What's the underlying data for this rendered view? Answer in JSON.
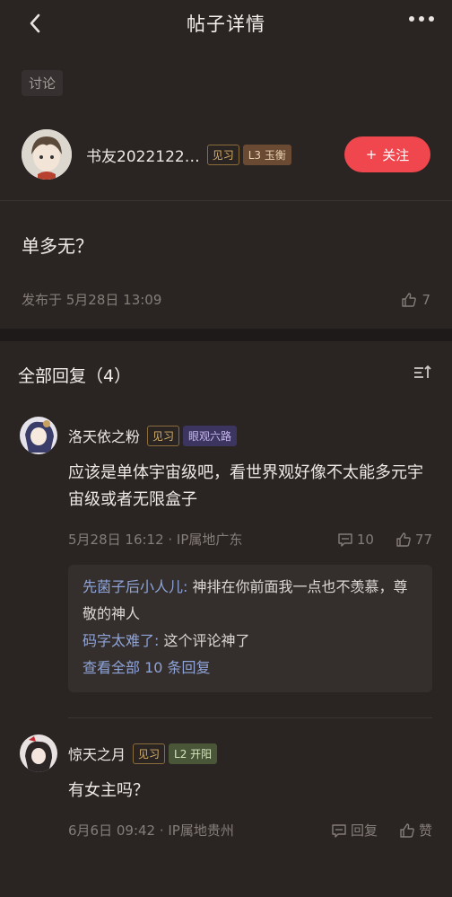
{
  "header": {
    "title": "帖子详情"
  },
  "post": {
    "tag": "讨论",
    "author": "书友2022122…",
    "badge_rank": "见习",
    "badge_level": "L3 玉衡",
    "follow_label": "关注",
    "body": "单多无？",
    "published": "发布于 5月28日 13:09",
    "likes": "7"
  },
  "replies": {
    "title": "全部回复（4）",
    "items": [
      {
        "name": "洛天依之粉",
        "badge_rank": "见习",
        "badge_extra": "眼观六路",
        "text": "应该是单体宇宙级吧，看世界观好像不太能多元宇宙级或者无限盒子",
        "meta": "5月28日 16:12 · IP属地广东",
        "comments": "10",
        "likes": "77",
        "sub": [
          {
            "user": "先菌子后小人儿:",
            "text": " 神排在你前面我一点也不羡慕，尊敬的神人"
          },
          {
            "user": "码字太难了:",
            "text": " 这个评论神了"
          }
        ],
        "sub_more": "查看全部 10 条回复"
      },
      {
        "name": "惊天之月",
        "badge_rank": "见习",
        "badge_extra": "L2 开阳",
        "text": "有女主吗？",
        "meta": "6月6日 09:42 · IP属地贵州",
        "comments": "回复",
        "likes": "赞"
      }
    ]
  }
}
